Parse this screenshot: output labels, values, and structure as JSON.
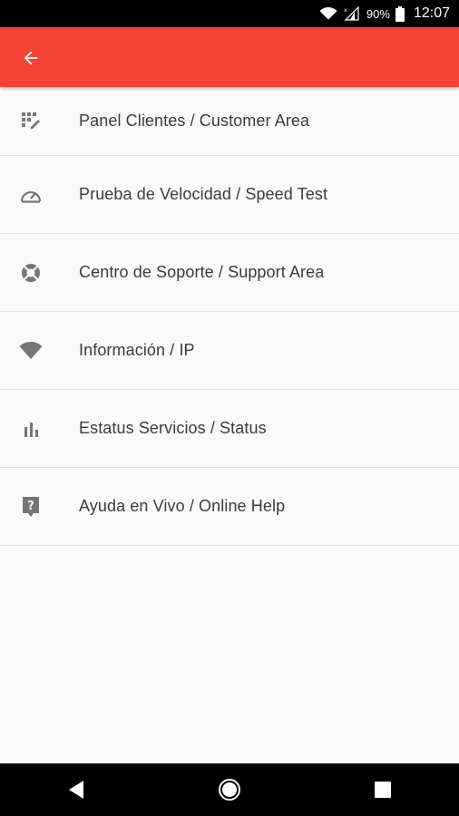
{
  "status_bar": {
    "battery": "90%",
    "time": "12:07",
    "icons": [
      "wifi-icon",
      "signal-icon",
      "battery-icon"
    ]
  },
  "app_bar": {
    "color": "#f44336",
    "back_icon": "arrow-back-icon"
  },
  "menu": {
    "items": [
      {
        "label": "Panel Clientes / Customer Area",
        "icon": "dashboard-icon"
      },
      {
        "label": "Prueba de Velocidad / Speed Test",
        "icon": "speedometer-icon"
      },
      {
        "label": "Centro de Soporte / Support Area",
        "icon": "lifebuoy-icon"
      },
      {
        "label": "Información / IP",
        "icon": "wifi-icon"
      },
      {
        "label": "Estatus Servicios / Status",
        "icon": "bar-chart-icon"
      },
      {
        "label": "Ayuda en Vivo / Online Help",
        "icon": "help-icon"
      }
    ]
  },
  "nav_bar": {
    "buttons": [
      "back-triangle-icon",
      "home-circle-icon",
      "recents-square-icon"
    ]
  }
}
